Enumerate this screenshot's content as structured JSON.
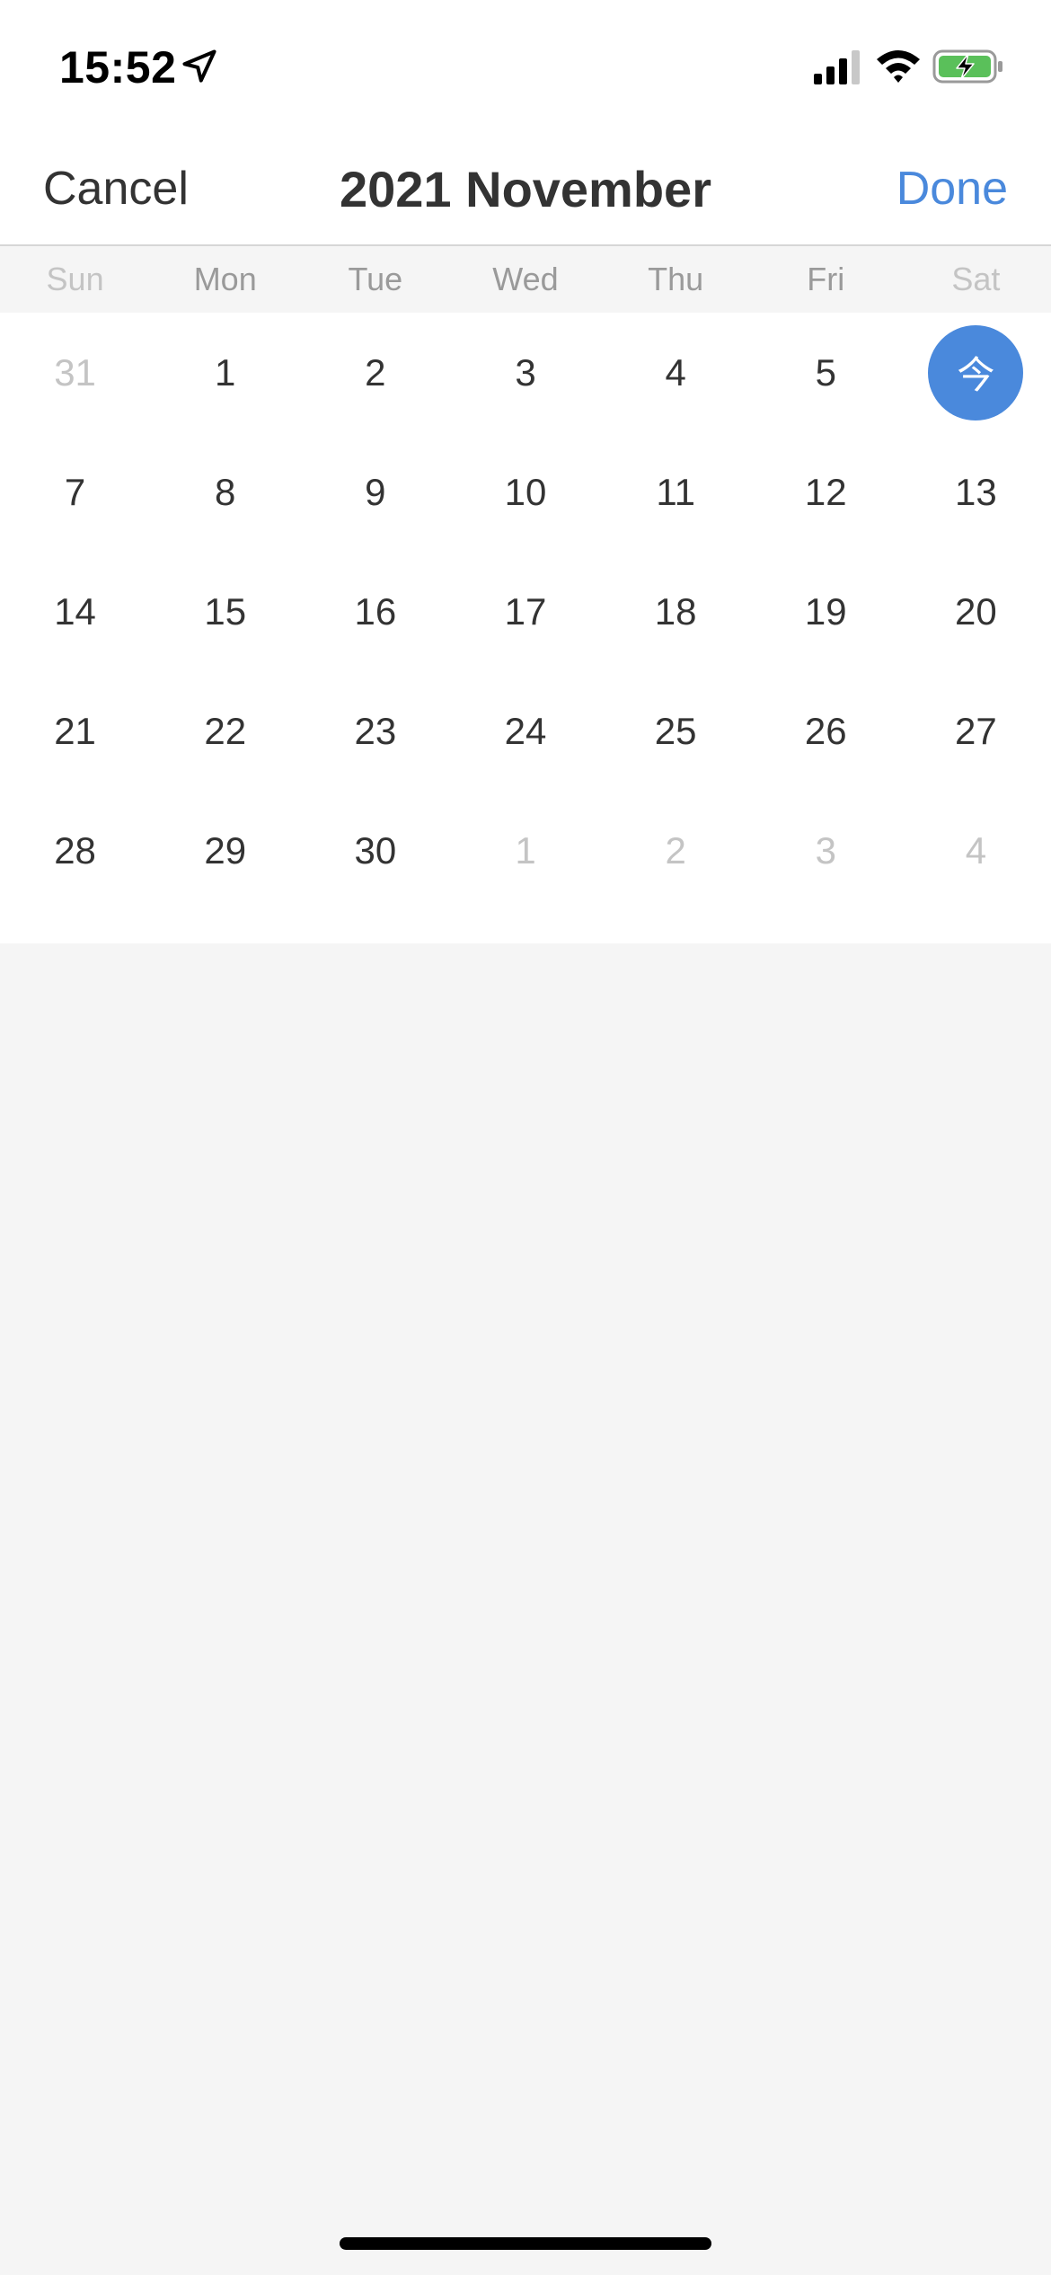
{
  "status_bar": {
    "time": "15:52",
    "icons": [
      "location-arrow-icon",
      "cellular-signal-icon",
      "wifi-icon",
      "battery-charging-icon"
    ]
  },
  "nav": {
    "cancel_label": "Cancel",
    "title": "2021 November",
    "done_label": "Done"
  },
  "colors": {
    "accent": "#4a89dc",
    "text": "#333333",
    "muted": "#c4c4c4",
    "weekend_header": "#c4c4c4",
    "weekday_header": "#9a9a9a",
    "background": "#f5f5f5"
  },
  "weekdays": [
    {
      "label": "Sun",
      "weekend": true
    },
    {
      "label": "Mon",
      "weekend": false
    },
    {
      "label": "Tue",
      "weekend": false
    },
    {
      "label": "Wed",
      "weekend": false
    },
    {
      "label": "Thu",
      "weekend": false
    },
    {
      "label": "Fri",
      "weekend": false
    },
    {
      "label": "Sat",
      "weekend": true
    }
  ],
  "weeks": [
    [
      {
        "label": "31",
        "muted": true
      },
      {
        "label": "1",
        "muted": false
      },
      {
        "label": "2",
        "muted": false
      },
      {
        "label": "3",
        "muted": false
      },
      {
        "label": "4",
        "muted": false
      },
      {
        "label": "5",
        "muted": false
      },
      {
        "label": "今",
        "muted": false,
        "today": true
      }
    ],
    [
      {
        "label": "7",
        "muted": false
      },
      {
        "label": "8",
        "muted": false
      },
      {
        "label": "9",
        "muted": false
      },
      {
        "label": "10",
        "muted": false
      },
      {
        "label": "11",
        "muted": false
      },
      {
        "label": "12",
        "muted": false
      },
      {
        "label": "13",
        "muted": false
      }
    ],
    [
      {
        "label": "14",
        "muted": false
      },
      {
        "label": "15",
        "muted": false
      },
      {
        "label": "16",
        "muted": false
      },
      {
        "label": "17",
        "muted": false
      },
      {
        "label": "18",
        "muted": false
      },
      {
        "label": "19",
        "muted": false
      },
      {
        "label": "20",
        "muted": false
      }
    ],
    [
      {
        "label": "21",
        "muted": false
      },
      {
        "label": "22",
        "muted": false
      },
      {
        "label": "23",
        "muted": false
      },
      {
        "label": "24",
        "muted": false
      },
      {
        "label": "25",
        "muted": false
      },
      {
        "label": "26",
        "muted": false
      },
      {
        "label": "27",
        "muted": false
      }
    ],
    [
      {
        "label": "28",
        "muted": false
      },
      {
        "label": "29",
        "muted": false
      },
      {
        "label": "30",
        "muted": false
      },
      {
        "label": "1",
        "muted": true
      },
      {
        "label": "2",
        "muted": true
      },
      {
        "label": "3",
        "muted": true
      },
      {
        "label": "4",
        "muted": true
      }
    ]
  ]
}
